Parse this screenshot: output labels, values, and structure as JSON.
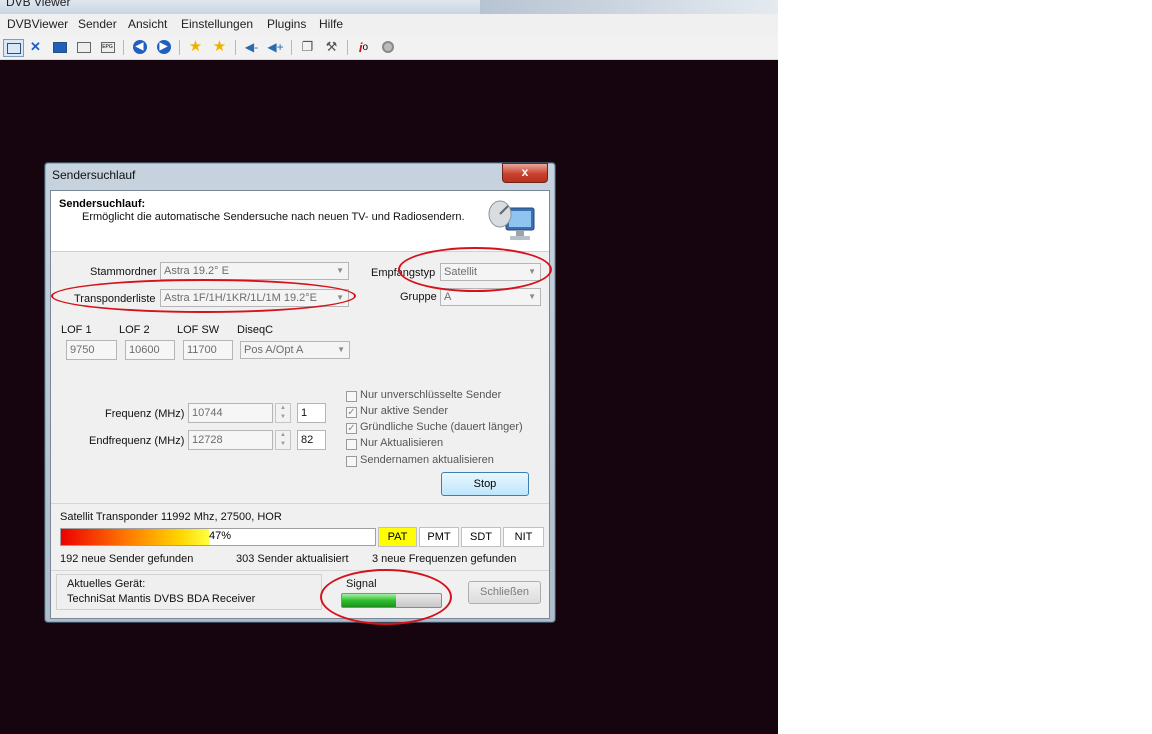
{
  "app": {
    "title": "DVB Viewer",
    "menu": [
      "DVBViewer",
      "Sender",
      "Ansicht",
      "Einstellungen",
      "Plugins",
      "Hilfe"
    ]
  },
  "toolbar": {
    "icons": [
      "window-mode-icon",
      "fullscreen-icon",
      "desktop-icon",
      "osd-icon",
      "epg-icon",
      "back-icon",
      "forward-icon",
      "favorite-icon",
      "favorite-add-icon",
      "volume-down-icon",
      "volume-up-icon",
      "copy-icon",
      "tools-icon",
      "info-icon",
      "record-icon"
    ]
  },
  "dialog": {
    "title": "Sendersuchlauf",
    "close_label": "x",
    "header_title": "Sendersuchlauf:",
    "header_desc": "Ermöglicht die automatische Sendersuche nach neuen TV- und Radiosendern.",
    "stammordner_label": "Stammordner",
    "stammordner_value": "Astra 19.2° E",
    "transponderliste_label": "Transponderliste",
    "transponderliste_value": "Astra 1F/1H/1KR/1L/1M 19.2°E",
    "empfangstyp_label": "Empfangstyp",
    "empfangstyp_value": "Satellit",
    "gruppe_label": "Gruppe",
    "gruppe_value": "A",
    "lof1_label": "LOF 1",
    "lof1_value": "9750",
    "lof2_label": "LOF 2",
    "lof2_value": "10600",
    "lofsw_label": "LOF SW",
    "lofsw_value": "11700",
    "diseqc_label": "DiseqC",
    "diseqc_value": "Pos A/Opt A",
    "frequenz_label": "Frequenz (MHz)",
    "frequenz_value": "10744",
    "frequenz_count": "1",
    "endfrequenz_label": "Endfrequenz (MHz)",
    "endfrequenz_value": "12728",
    "endfrequenz_count": "82",
    "options": [
      {
        "label": "Nur unverschlüsselte Sender",
        "checked": false
      },
      {
        "label": "Nur aktive Sender",
        "checked": true
      },
      {
        "label": "Gründliche Suche (dauert länger)",
        "checked": true
      },
      {
        "label": "Nur Aktualisieren",
        "checked": false
      },
      {
        "label": "Sendernamen aktualisieren",
        "checked": false
      }
    ],
    "stop_label": "Stop",
    "transponder_status": "Satellit Transponder 11992 Mhz, 27500, HOR",
    "progress_percent": 47,
    "progress_label": "47%",
    "tables": [
      "PAT",
      "PMT",
      "SDT",
      "NIT"
    ],
    "active_table": "PAT",
    "found_text": "192 neue Sender gefunden",
    "updated_text": "303 Sender aktualisiert",
    "freq_text": "3 neue Frequenzen gefunden",
    "device_label": "Aktuelles Gerät:",
    "device_value": "TechniSat Mantis DVBS BDA Receiver",
    "signal_label": "Signal",
    "signal_level": 0.55,
    "close_button_label": "Schließen"
  },
  "colors": {
    "annotation_red": "#d5121b",
    "background_dark": "#16050e",
    "active_table_yellow": "#ffff00",
    "signal_green": "#2fbf2f"
  }
}
